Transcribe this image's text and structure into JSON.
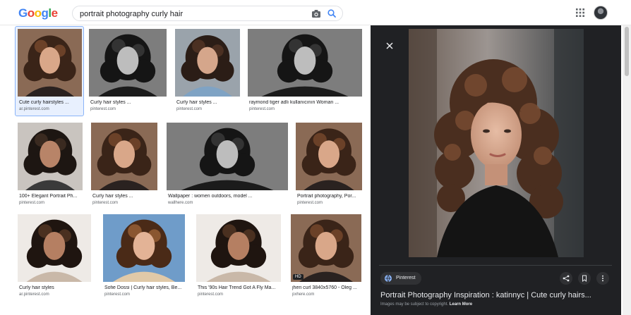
{
  "header": {
    "logo": [
      "G",
      "o",
      "o",
      "g",
      "l",
      "e"
    ],
    "logo_colors": [
      "#4285f4",
      "#ea4335",
      "#fbbc05",
      "#4285f4",
      "#34a853",
      "#ea4335"
    ],
    "search_value": "portrait photography curly hair",
    "icons": [
      "camera-icon",
      "search-icon",
      "apps-grid-icon",
      "avatar"
    ]
  },
  "results": [
    {
      "title": "Cute curly hairstyles ...",
      "source": "ar.pinterest.com",
      "tone": "warm",
      "selected": true
    },
    {
      "title": "Curly hair styles ...",
      "source": "pinterest.com",
      "tone": "bw"
    },
    {
      "title": "Curly hair styles ...",
      "source": "pinterest.com",
      "tone": "cool"
    },
    {
      "title": "raymond tiger adlı kullanıcının Woman ...",
      "source": "pinterest.com",
      "tone": "bw"
    },
    {
      "title": "100+ Elegant Portrait Ph...",
      "source": "pinterest.com",
      "tone": "neutral"
    },
    {
      "title": "Curly hair styles ...",
      "source": "pinterest.com",
      "tone": "warm"
    },
    {
      "title": "Wallpaper : women outdoors, model ...",
      "source": "wallhere.com",
      "tone": "bw"
    },
    {
      "title": "Portrait photography, Por...",
      "source": "pinterest.com",
      "tone": "warm"
    },
    {
      "title": "Curly hair styles",
      "source": "ar.pinterest.com",
      "tone": "light"
    },
    {
      "title": "Sofie Dossi | Curly hair styles, Be...",
      "source": "pinterest.com",
      "tone": "blue"
    },
    {
      "title": "This '90s Hair Trend Got A Fly Ma...",
      "source": "pinterest.com",
      "tone": "light"
    },
    {
      "title": "jheri curl 3840x5760 - Oleg ...",
      "source": "pxhere.com",
      "tone": "warm",
      "badge": "HD"
    }
  ],
  "panel": {
    "source_chip": "Pinterest",
    "title": "Portrait Photography Inspiration : katinnyc | Cute curly hairs...",
    "copyright_prefix": "Images may be subject to copyright.",
    "learn_more": "Learn More"
  },
  "colors": {
    "panel_bg": "#202124",
    "accent": "#1a73e8",
    "selected_border": "#8ab4f8"
  }
}
